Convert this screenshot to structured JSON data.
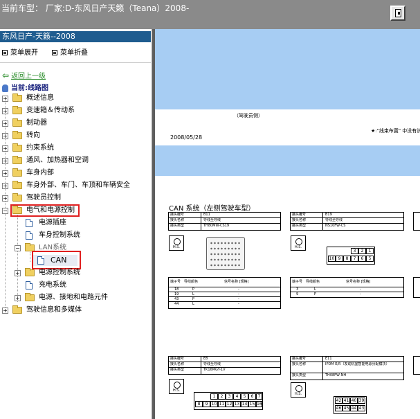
{
  "window": {
    "title": "当前车型：  厂家:D-东风日产天籁（Teana）2008-"
  },
  "left_panel": {
    "header": "东风日产-天籁--2008",
    "expand_all": "菜单展开",
    "collapse_all": "菜单折叠",
    "back": "返回上一级",
    "current": "当前:线路图",
    "tree": [
      {
        "label": "概述信息",
        "type": "folder",
        "state": "collapsed",
        "level": 0
      },
      {
        "label": "变速箱＆传动系",
        "type": "folder",
        "state": "collapsed",
        "level": 0
      },
      {
        "label": "制动器",
        "type": "folder",
        "state": "collapsed",
        "level": 0
      },
      {
        "label": "转向",
        "type": "folder",
        "state": "collapsed",
        "level": 0
      },
      {
        "label": "约束系统",
        "type": "folder",
        "state": "collapsed",
        "level": 0
      },
      {
        "label": "通风、加热器和空调",
        "type": "folder",
        "state": "collapsed",
        "level": 0
      },
      {
        "label": "车身内部",
        "type": "folder",
        "state": "collapsed",
        "level": 0
      },
      {
        "label": "车身外部、车门、车顶和车辆安全",
        "type": "folder",
        "state": "collapsed",
        "level": 0
      },
      {
        "label": "驾驶员控制",
        "type": "folder",
        "state": "collapsed",
        "level": 0
      },
      {
        "label": "电气和电源控制",
        "type": "folder",
        "state": "expanded",
        "level": 0
      },
      {
        "label": "电源插座",
        "type": "doc",
        "level": 1
      },
      {
        "label": "车身控制系统",
        "type": "doc",
        "level": 1
      },
      {
        "label": "LAN系统",
        "type": "folder",
        "state": "expanded",
        "level": 1
      },
      {
        "label": "CAN",
        "type": "doc",
        "level": 2,
        "selected": true
      },
      {
        "label": "电源控制系统",
        "type": "folder",
        "state": "collapsed",
        "level": 1
      },
      {
        "label": "充电系统",
        "type": "doc",
        "level": 1
      },
      {
        "label": "电源、接地和电路元件",
        "type": "folder",
        "state": "collapsed",
        "level": 1
      },
      {
        "label": "驾驶信息和多媒体",
        "type": "folder",
        "state": "collapsed",
        "level": 0
      }
    ]
  },
  "document": {
    "driver_label": "（驾驶员侧）",
    "date": "2008/05/28",
    "note": "★:\"线束布置\" 中没有说明",
    "section_title": "CAN 系统（左侧驾驶车型）",
    "connectors": [
      {
        "no_label": "接头编号",
        "no": "B11",
        "name_label": "接头名称",
        "name": "导线至导线",
        "type_label": "接头类型",
        "type": "TH80MW-CS19"
      },
      {
        "no_label": "接头编号",
        "no": "B19",
        "name_label": "接头名称",
        "name": "导线至导线",
        "type_label": "接头类型",
        "type": "NS10FW-CS"
      },
      {
        "no_label": "接头编号",
        "no": "E8",
        "name_label": "接头名称",
        "name": "导线至导线",
        "type_label": "接头类型",
        "type": "TK16MGY-1V"
      },
      {
        "no_label": "接头编号",
        "no": "E11",
        "name_label": "接头名称",
        "name": "IPDM E/R（发动机室智能电源分配模块）",
        "type_label": "接头类型",
        "type": "TH08FW-NH"
      }
    ],
    "pin_table_headers": {
      "pin": "端子号",
      "color": "导线颜色",
      "signal": "信号名称 [规格]"
    },
    "pin_table_1": [
      {
        "pin": "18",
        "color": "P",
        "signal": "-"
      },
      {
        "pin": "19",
        "color": "L",
        "signal": "-"
      },
      {
        "pin": "43",
        "color": "P",
        "signal": "-"
      },
      {
        "pin": "44",
        "color": "L",
        "signal": "-"
      }
    ],
    "pin_table_2": [
      {
        "pin": "3",
        "color": "L",
        "signal": "-"
      },
      {
        "pin": "9",
        "color": "P",
        "signal": "-"
      }
    ],
    "b19_pins_top": [
      "3",
      "2",
      "1"
    ],
    "b19_pins_bottom": [
      "10",
      "9",
      "8",
      "7",
      "6",
      "5"
    ],
    "e8_pins_top": [
      "1",
      "2",
      "3",
      "4",
      "5",
      "6",
      "7"
    ],
    "e8_pins_bottom": [
      "8",
      "9",
      "10",
      "11",
      "12",
      "13",
      "14",
      "15",
      "16"
    ],
    "e11_pins_top": [
      "42",
      "41",
      "40",
      "39"
    ],
    "e11_pins_bottom": [
      "46",
      "45",
      "44",
      "43"
    ],
    "hs_label": "H.S."
  },
  "colors": {
    "title_bar": "#8a8a8a",
    "header_blue": "#1f5c8f",
    "doc_band": "#a7cdf3",
    "highlight_red": "#e02020"
  }
}
